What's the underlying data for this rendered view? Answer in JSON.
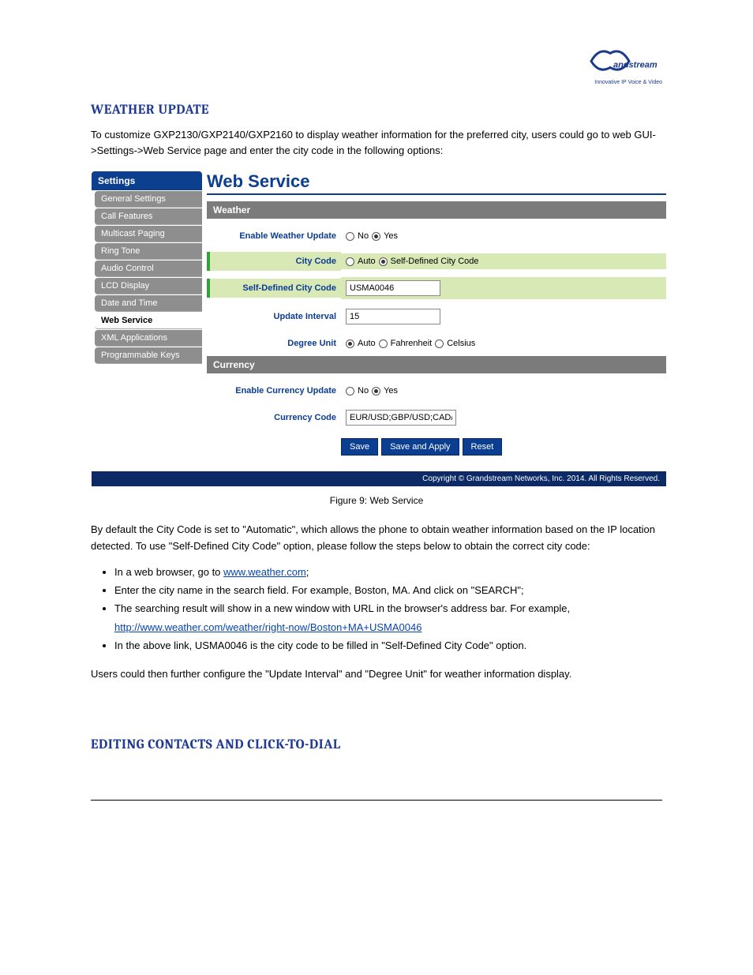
{
  "logo": {
    "brand": "Grandstream",
    "tagline": "Innovative IP Voice & Video"
  },
  "heading1": "WEATHER UPDATE",
  "intro": "To customize GXP2130/GXP2140/GXP2160 to display weather information for the preferred city, users could go to web GUI->Settings->Web Service page and enter the city code in the following options:",
  "ui": {
    "sidebar_header": "Settings",
    "sidebar_items": [
      {
        "label": "General Settings",
        "active": false
      },
      {
        "label": "Call Features",
        "active": false
      },
      {
        "label": "Multicast Paging",
        "active": false
      },
      {
        "label": "Ring Tone",
        "active": false
      },
      {
        "label": "Audio Control",
        "active": false
      },
      {
        "label": "LCD Display",
        "active": false
      },
      {
        "label": "Date and Time",
        "active": false
      },
      {
        "label": "Web Service",
        "active": true
      },
      {
        "label": "XML Applications",
        "active": false
      },
      {
        "label": "Programmable Keys",
        "active": false
      }
    ],
    "page_title": "Web Service",
    "weather": {
      "section_label": "Weather",
      "rows": {
        "enable": {
          "label": "Enable Weather Update",
          "opt_no": "No",
          "opt_yes": "Yes",
          "selected": "Yes"
        },
        "citycode": {
          "label": "City Code",
          "opt_auto": "Auto",
          "opt_self": "Self-Defined City Code",
          "selected": "Self-Defined City Code"
        },
        "selfcity": {
          "label": "Self-Defined City Code",
          "value": "USMA0046"
        },
        "interval": {
          "label": "Update Interval",
          "value": "15"
        },
        "degree": {
          "label": "Degree Unit",
          "opt_auto": "Auto",
          "opt_f": "Fahrenheit",
          "opt_c": "Celsius",
          "selected": "Auto"
        }
      }
    },
    "currency": {
      "section_label": "Currency",
      "rows": {
        "enable": {
          "label": "Enable Currency Update",
          "opt_no": "No",
          "opt_yes": "Yes",
          "selected": "Yes"
        },
        "code": {
          "label": "Currency Code",
          "value": "EUR/USD;GBP/USD;CAD/U"
        }
      }
    },
    "buttons": {
      "save": "Save",
      "save_apply": "Save and Apply",
      "reset": "Reset"
    },
    "copyright": "Copyright © Grandstream Networks, Inc. 2014. All Rights Reserved."
  },
  "figure_caption": "Figure 9: Web Service",
  "instructions_intro": "By default the City Code is set to \"Automatic\", which allows the phone to obtain weather information based on the IP location detected. To use \"Self-Defined City Code\" option, please follow the steps below to obtain the correct city code:",
  "bullets": [
    {
      "pre": "In a web browser, go to ",
      "link": "www.weather.com",
      "post": ";"
    },
    {
      "pre": "Enter the city name in the search field. For example, Boston, MA. And click on \"SEARCH\";",
      "link": "",
      "post": ""
    },
    {
      "pre": "The searching result will show in a new window with URL in the browser's address bar. For example, ",
      "link": "http://www.weather.com/weather/right-now/Boston+MA+USMA0046",
      "post": ""
    },
    {
      "pre": "In the above link, USMA0046 is the city code to be filled in \"Self-Defined City Code\" option.",
      "link": "",
      "post": ""
    }
  ],
  "post_list": "Users could then further configure the \"Update Interval\" and \"Degree Unit\" for weather information display.",
  "heading2": "EDITING CONTACTS AND CLICK-TO-DIAL"
}
